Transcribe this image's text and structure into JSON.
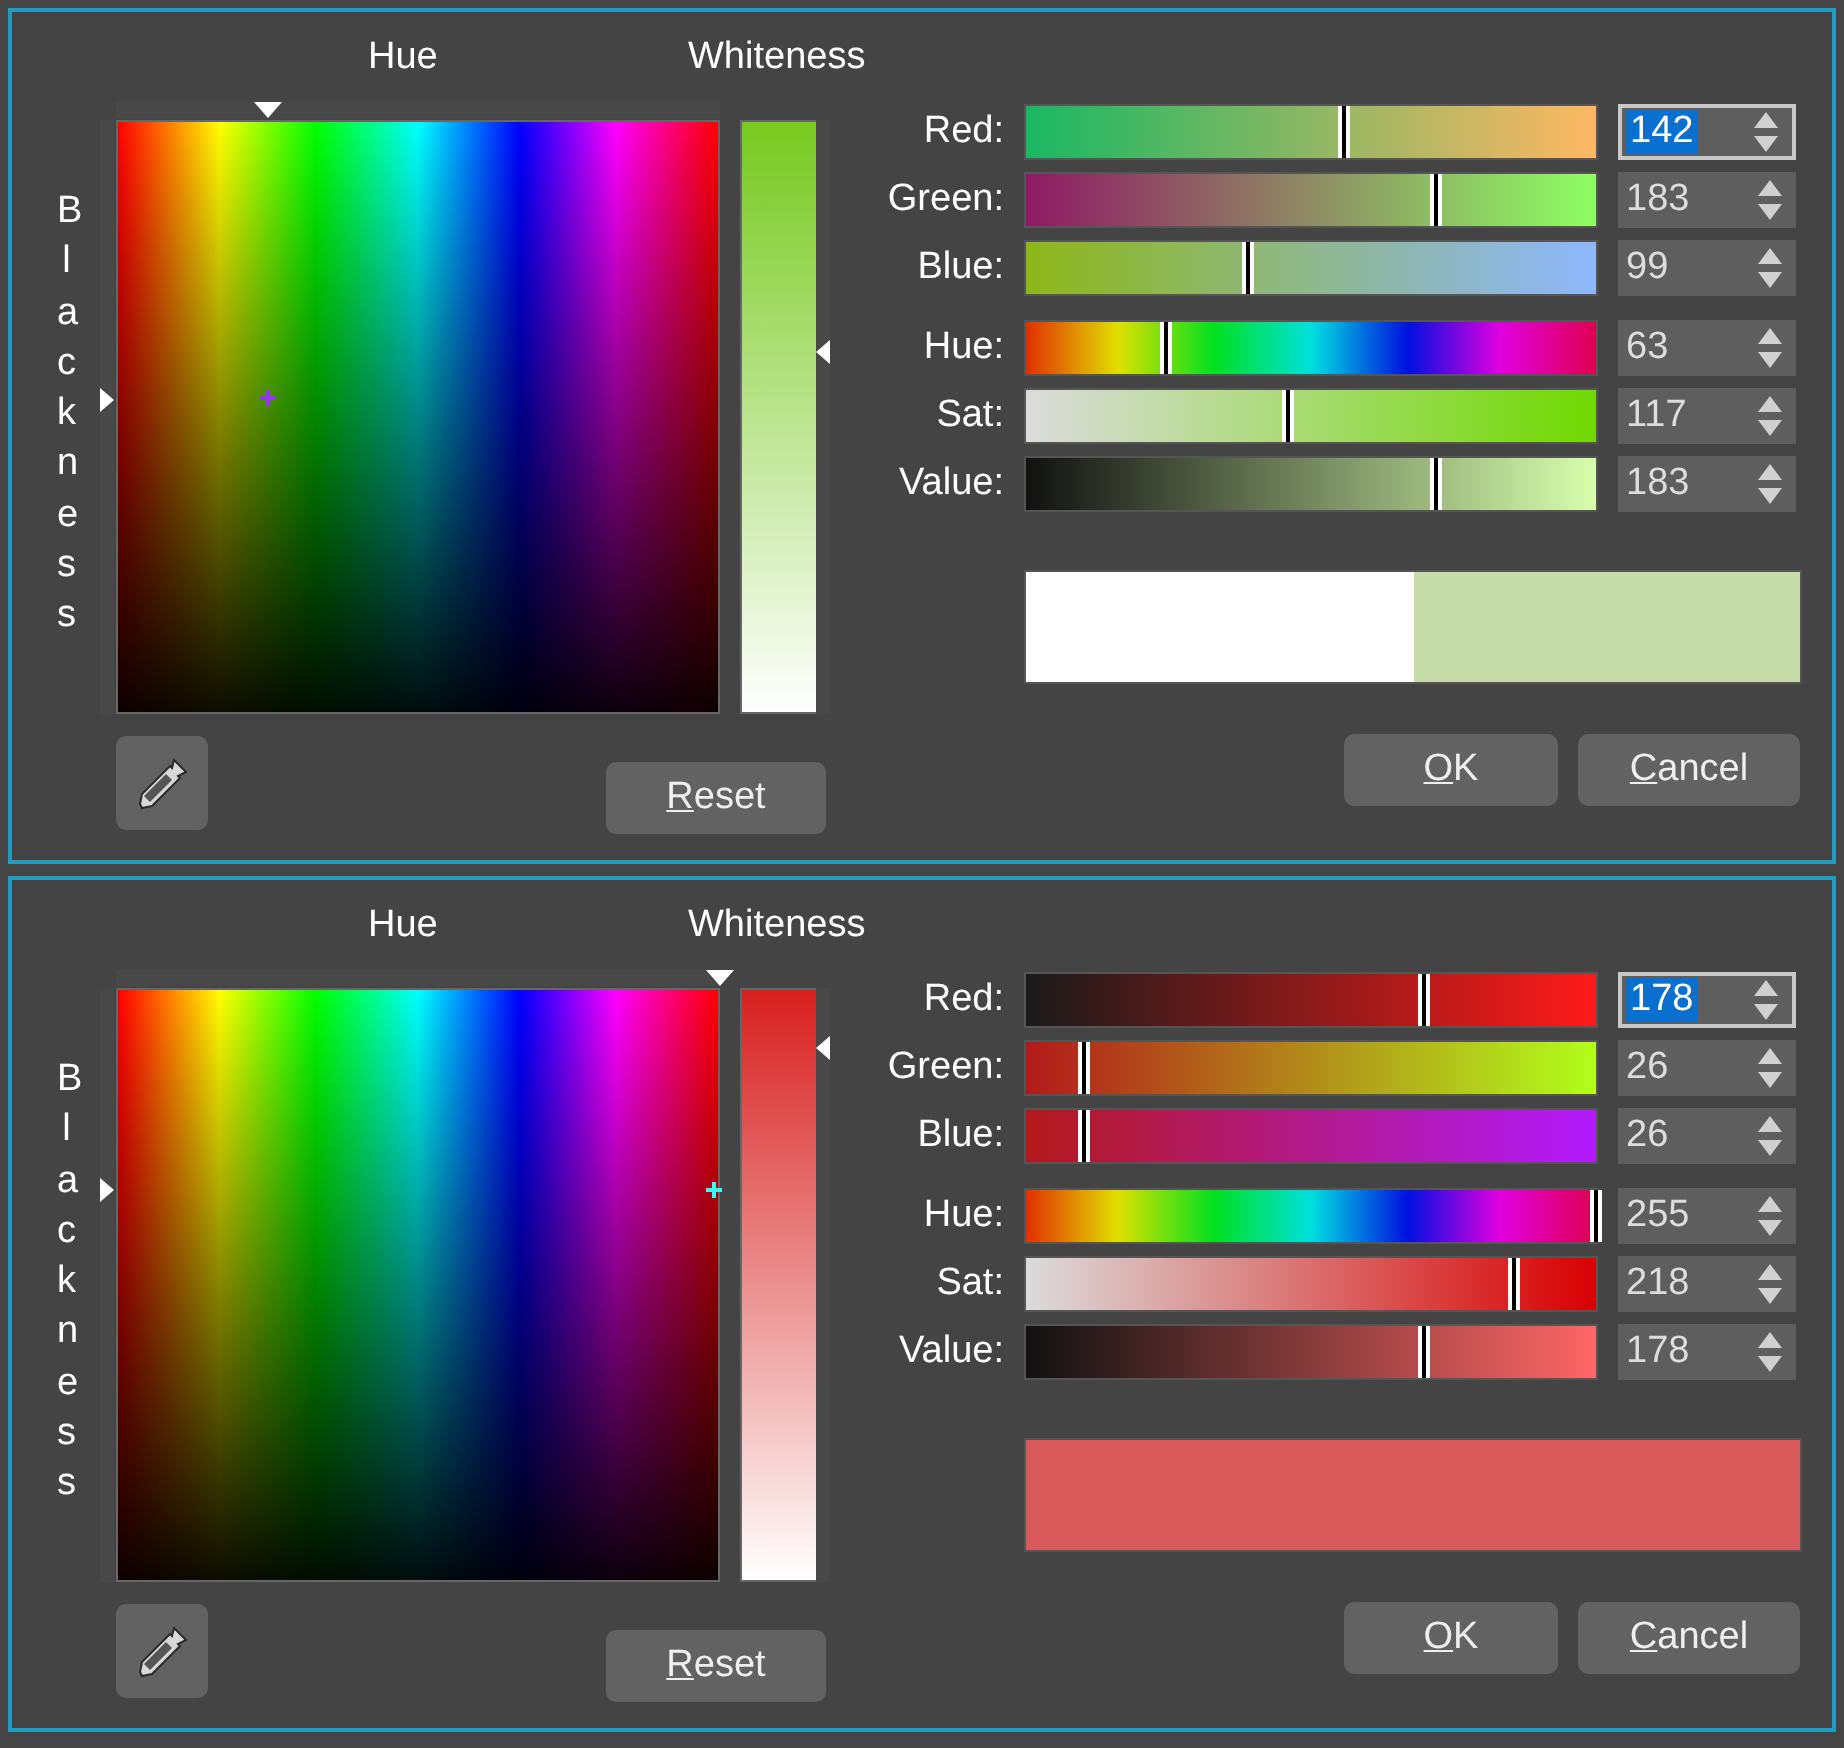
{
  "dialogs": [
    {
      "hue_label": "Hue",
      "whiteness_label": "Whiteness",
      "blackness_label": "Blackness",
      "hue_marker": {
        "level": 0.25
      },
      "blackness_marker": {
        "level": 0.47
      },
      "whiteness_marker": {
        "level": 0.39
      },
      "sliders": [
        {
          "kind": "red",
          "label": "Red:",
          "level": 0.557,
          "value": "142",
          "focused": true
        },
        {
          "kind": "green",
          "label": "Green:",
          "level": 0.718,
          "value": "183",
          "focused": false
        },
        {
          "kind": "blue",
          "label": "Blue:",
          "level": 0.388,
          "value": "99",
          "focused": false
        },
        {
          "kind": "hue",
          "label": "Hue:",
          "level": 0.247,
          "value": "63",
          "focused": false
        },
        {
          "kind": "sat",
          "label": "Sat:",
          "level": 0.459,
          "value": "117",
          "focused": false
        },
        {
          "kind": "value",
          "label": "Value:",
          "level": 0.718,
          "value": "183",
          "focused": false
        }
      ],
      "swatches": [
        {
          "color": "#ffffff"
        },
        {
          "color": "#c5dca8"
        }
      ],
      "reset_button": {
        "label": "Reset"
      },
      "buttons": [
        {
          "label": "OK"
        },
        {
          "label": "Cancel"
        }
      ]
    },
    {
      "hue_label": "Hue",
      "whiteness_label": "Whiteness",
      "blackness_label": "Blackness",
      "hue_marker": {
        "level": 1.0
      },
      "blackness_marker": {
        "level": 0.34
      },
      "whiteness_marker": {
        "level": 0.1
      },
      "sliders": [
        {
          "kind": "red",
          "label": "Red:",
          "level": 0.698,
          "value": "178",
          "focused": true
        },
        {
          "kind": "green",
          "label": "Green:",
          "level": 0.102,
          "value": "26",
          "focused": false
        },
        {
          "kind": "blue",
          "label": "Blue:",
          "level": 0.102,
          "value": "26",
          "focused": false
        },
        {
          "kind": "hue",
          "label": "Hue:",
          "level": 1.0,
          "value": "255",
          "focused": false
        },
        {
          "kind": "sat",
          "label": "Sat:",
          "level": 0.855,
          "value": "218",
          "focused": false
        },
        {
          "kind": "value",
          "label": "Value:",
          "level": 0.698,
          "value": "178",
          "focused": false
        }
      ],
      "swatches": [
        {
          "color": "#d95a5a"
        }
      ],
      "reset_button": {
        "label": "Reset"
      },
      "buttons": [
        {
          "label": "OK"
        },
        {
          "label": "Cancel"
        }
      ]
    }
  ]
}
